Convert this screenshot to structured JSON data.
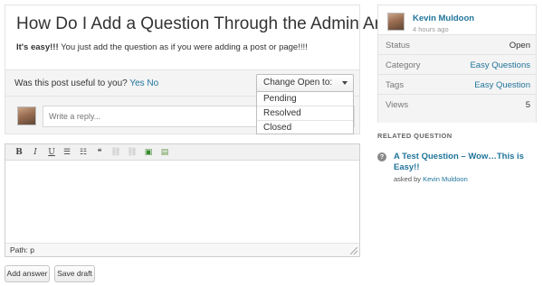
{
  "question": {
    "title": "How Do I Add a Question Through the Admin Area?",
    "body_bold": "It's easy!!!",
    "body_rest": " You just add the question as if you were adding a post or page!!!!"
  },
  "useful": {
    "prompt": "Was this post useful to you?",
    "yes": "Yes",
    "no": "No"
  },
  "status_dropdown": {
    "label": "Change Open to:",
    "options": [
      "Pending",
      "Resolved",
      "Closed"
    ]
  },
  "reply": {
    "placeholder": "Write a reply..."
  },
  "editor": {
    "toolbar": [
      {
        "name": "bold-icon",
        "glyph": "B"
      },
      {
        "name": "italic-icon",
        "glyph": "I"
      },
      {
        "name": "underline-icon",
        "glyph": "U"
      },
      {
        "name": "bullet-list-icon",
        "glyph": "☰"
      },
      {
        "name": "numbered-list-icon",
        "glyph": "☷"
      },
      {
        "name": "blockquote-icon",
        "glyph": "❝"
      },
      {
        "name": "link-icon",
        "glyph": "⛓"
      },
      {
        "name": "unlink-icon",
        "glyph": "⛓"
      },
      {
        "name": "image-icon",
        "glyph": "▣"
      },
      {
        "name": "html-icon",
        "glyph": "▤"
      }
    ],
    "path": "Path: p"
  },
  "buttons": {
    "add_answer": "Add answer",
    "save_draft": "Save draft"
  },
  "author": {
    "name": "Kevin Muldoon",
    "time": "4 hours ago"
  },
  "meta": [
    {
      "key": "Status",
      "value": "Open",
      "link": false
    },
    {
      "key": "Category",
      "value": "Easy Questions",
      "link": true
    },
    {
      "key": "Tags",
      "value": "Easy Question",
      "link": true
    },
    {
      "key": "Views",
      "value": "5",
      "link": false
    }
  ],
  "related": {
    "heading": "RELATED QUESTION",
    "icon": "?",
    "title": "A Test Question – Wow…This is Easy!!",
    "asked_by": "asked by",
    "asker": "Kevin Muldoon"
  },
  "colors": {
    "link": "#21759b",
    "panel": "#f4f4f4",
    "border": "#e3e3e3"
  }
}
